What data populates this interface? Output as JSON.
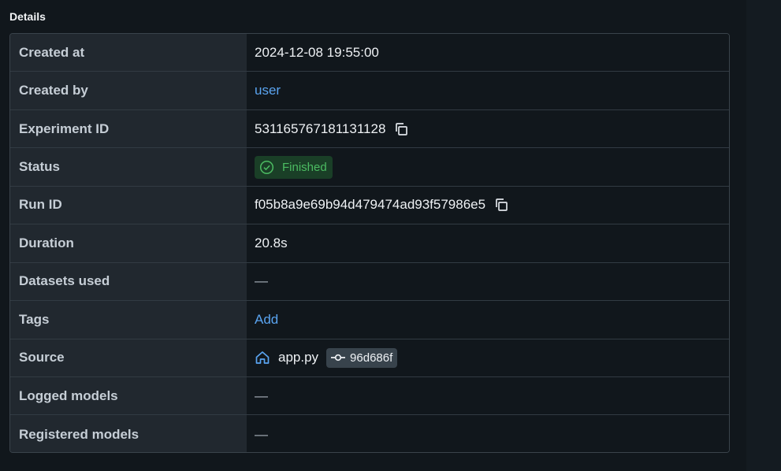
{
  "section": {
    "title": "Details"
  },
  "rows": {
    "created_at": {
      "label": "Created at",
      "value": "2024-12-08 19:55:00"
    },
    "created_by": {
      "label": "Created by",
      "value": "user"
    },
    "experiment_id": {
      "label": "Experiment ID",
      "value": "531165767181131128"
    },
    "status": {
      "label": "Status",
      "value": "Finished"
    },
    "run_id": {
      "label": "Run ID",
      "value": "f05b8a9e69b94d479474ad93f57986e5"
    },
    "duration": {
      "label": "Duration",
      "value": "20.8s"
    },
    "datasets_used": {
      "label": "Datasets used",
      "value": "—"
    },
    "tags": {
      "label": "Tags",
      "value": "Add"
    },
    "source": {
      "label": "Source",
      "file": "app.py",
      "commit": "96d686f"
    },
    "logged_models": {
      "label": "Logged models",
      "value": "—"
    },
    "registered_models": {
      "label": "Registered models",
      "value": "—"
    }
  },
  "icons": {
    "copy": "copy-icon",
    "status": "check-circle-icon",
    "source": "home-icon",
    "commit": "git-commit-icon"
  },
  "colors": {
    "link": "#5aa4f0",
    "status_text": "#4cbc62",
    "status_bg": "#1a3f27",
    "key_bg": "#21282f",
    "value_bg": "#11171c"
  }
}
